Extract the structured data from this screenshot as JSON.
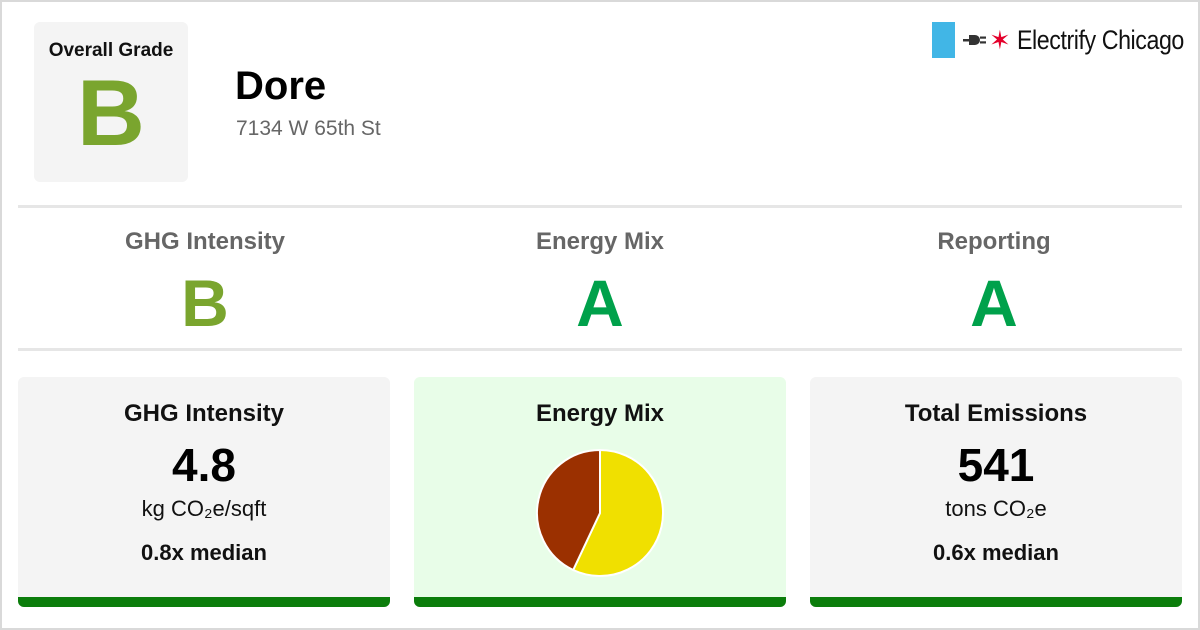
{
  "overall": {
    "label": "Overall Grade",
    "grade": "B"
  },
  "building": {
    "name": "Dore",
    "address": "7134 W 65th St"
  },
  "logo": {
    "text": "Electrify Chicago",
    "star": "✶"
  },
  "grades": [
    {
      "name": "GHG Intensity",
      "grade": "B",
      "color": "#7aa52e"
    },
    {
      "name": "Energy Mix",
      "grade": "A",
      "color": "#00a14b"
    },
    {
      "name": "Reporting",
      "grade": "A",
      "color": "#00a14b"
    }
  ],
  "cards": {
    "ghg": {
      "title": "GHG Intensity",
      "value": "4.8",
      "unit": "kg CO₂e/sqft",
      "median": "0.8x median"
    },
    "mix": {
      "title": "Energy Mix"
    },
    "emissions": {
      "title": "Total Emissions",
      "value": "541",
      "unit": "tons CO₂e",
      "median": "0.6x median"
    }
  },
  "colors": {
    "overall_grade": "#7aa52e",
    "grade_a": "#00a14b",
    "bar": "#0b7d0b",
    "electricity": "#f0e000",
    "gas": "#9b3000"
  },
  "chart_data": {
    "type": "pie",
    "title": "",
    "slices": [
      {
        "value": 57,
        "color": "#f0e000"
      },
      {
        "value": 43,
        "color": "#9b3000"
      }
    ]
  }
}
